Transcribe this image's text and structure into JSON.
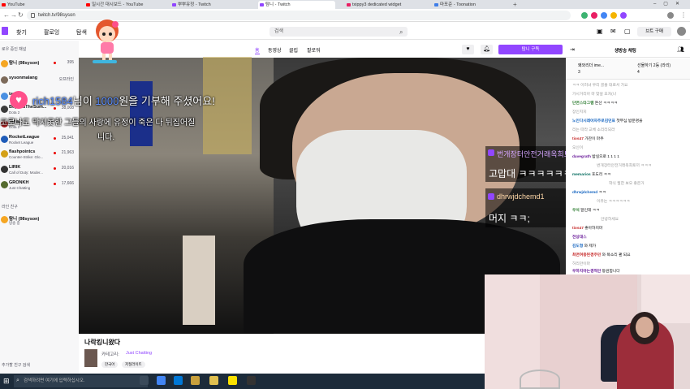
{
  "browser": {
    "tabs": [
      {
        "label": "YouTube",
        "icon": "youtube-icon",
        "color": "#ff0000"
      },
      {
        "label": "일시간 대시보드 - YouTube",
        "icon": "youtube-icon",
        "color": "#ff0000"
      },
      {
        "label": "뿌뿌유정 - Twitch",
        "icon": "twitch-icon",
        "color": "#9146ff"
      },
      {
        "label": "탐니 - Twitch",
        "icon": "twitch-icon",
        "color": "#9146ff"
      },
      {
        "label": "txippy3 dedicated widget",
        "icon": "widget-icon",
        "color": "#e91e63"
      },
      {
        "label": "마포준 - Toonation",
        "icon": "toonation-icon",
        "color": "#3f7ee8"
      }
    ],
    "url": "twitch.tv/98syson"
  },
  "twitch": {
    "nav": {
      "browse": "찾기",
      "following": "팔로잉",
      "esports": "탐색"
    },
    "search_placeholder": "검색",
    "login_label": "브트 구매",
    "sidebar": {
      "section_followed": "로우 중인 채널",
      "channels": [
        {
          "name": "탐니 (98syson)",
          "game": "",
          "viewers": "395",
          "color": "#f5a623"
        },
        {
          "name": "sysonmalang",
          "game": "",
          "viewers": "오프라인",
          "color": "#7c6a5a"
        },
        {
          "name": "tarbu",
          "game": "",
          "viewers": "",
          "color": "#4a90e2"
        },
        {
          "name": "BeyondTheSum...",
          "game": "Dota 2",
          "viewers": "38,008",
          "color": "#3b3b3b"
        },
        {
          "name": "Dota2",
          "game": "Dota 2",
          "viewers": "",
          "color": "#b22222"
        },
        {
          "name": "RocketLeague",
          "game": "Rocket League",
          "viewers": "25,041",
          "color": "#1e5bb8"
        },
        {
          "name": "flashpointcs",
          "game": "Counter-Strike: Glo...",
          "viewers": "21,963",
          "color": "#d4a017"
        },
        {
          "name": "LIRIK",
          "game": "Call of Duty: Moder...",
          "viewers": "20,016",
          "color": "#333"
        },
        {
          "name": "GRONKH",
          "game": "Just Chatting",
          "viewers": "17,666",
          "color": "#556b2f"
        }
      ],
      "section_friends": "라인 친구",
      "friends": [
        {
          "name": "탐니 (98syson)",
          "status": "방송 중",
          "color": "#f5a623"
        }
      ],
      "friend_search": "추가할 친구 검색"
    },
    "channel_tabs": {
      "home": "홈",
      "videos": "동영상",
      "clips": "클립",
      "following": "팔로워"
    },
    "follow_label": "탐니 구독",
    "donation": {
      "name": "rich1584",
      "mid1": "님이 ",
      "amount": "1000",
      "mid2": "원을 기부해 주셨어요!",
      "message_line1": "코로나도 막지못한 그들의 사랑에 유정이 죽은 다 뒤집어질",
      "message_line2": "니다."
    },
    "overlay_chat": [
      {
        "name": "번개장터안전거래옥희토끼",
        "message": "고맙대 ㅋㅋㅋㅋㅋㅋㅋㅋ"
      },
      {
        "name": "dhrwjdchemd1",
        "message": "머지 ㅋㅋ;"
      }
    ],
    "stream": {
      "title": "나락킹니왔다",
      "category_label": "카테고리:",
      "category": "Just Chatting",
      "tags": [
        "한국어",
        "저질러이트"
      ]
    },
    "chat": {
      "title": "생방송 채팅",
      "pinned": [
        {
          "text": "왜와리더 ime..."
        },
        {
          "text": "선물하기 2등 (라리)"
        },
        {
          "text": "3"
        },
        {
          "text": "4"
        }
      ],
      "lines": [
        {
          "user": "",
          "text": "ㅋㅋ 이러녀 우리 골몰 대로서 가요"
        },
        {
          "user": "",
          "text": "가시거리아 마 맞살 오자(나"
        },
        {
          "user": "단면스타그램",
          "text": "돈산 ㅋㅋㅋㅋ"
        },
        {
          "user": "",
          "text": "장인치지"
        },
        {
          "user": "노인다시레아자주로김던표",
          "text": "첫부심 밤운명을"
        },
        {
          "user": "",
          "text": "리는 따라 교체 소리리되라"
        },
        {
          "user": "tios47",
          "text": "가잔이 마주"
        },
        {
          "user": "",
          "text": "오신이"
        },
        {
          "user": "davegrath",
          "text": "밤실으로 1 1 1 1"
        },
        {
          "user": "",
          "text": "번개장터안전거래옥희토끼 ㅋㅋㅋ"
        },
        {
          "user": "memarios",
          "text": "포도리 ㅋㅋ"
        },
        {
          "user": "",
          "text": "학식 필한 보오 좋은거"
        },
        {
          "user": "dhrwjdchemd",
          "text": "ㅋㅋ"
        },
        {
          "user": "",
          "text": "이유는 ㅋㅋㅋㅋㅋㅋ"
        },
        {
          "user": "우석",
          "text": "알인데 ㅋㅋ"
        },
        {
          "user": "",
          "text": "안녕하세요"
        },
        {
          "user": "tios47",
          "text": "좋아하지마"
        },
        {
          "user": "전상대스",
          "text": ""
        },
        {
          "user": "김도형",
          "text": "와 제가"
        },
        {
          "user": "최면여중된경주민",
          "text": "와 목소리 괜 되요"
        },
        {
          "user": "",
          "text": "허리만이마"
        },
        {
          "user": "우하지아는경적안",
          "text": "등원합니다"
        }
      ]
    }
  },
  "taskbar": {
    "search_placeholder": "검색하려면 여기에 입력하십시오."
  }
}
